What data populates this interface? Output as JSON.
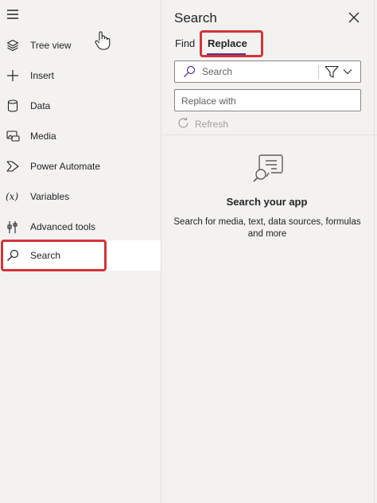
{
  "sidebar": {
    "items": [
      {
        "label": "Tree view",
        "icon": "layers-icon"
      },
      {
        "label": "Insert",
        "icon": "plus-icon"
      },
      {
        "label": "Data",
        "icon": "database-icon"
      },
      {
        "label": "Media",
        "icon": "media-icon"
      },
      {
        "label": "Power Automate",
        "icon": "power-automate-icon"
      },
      {
        "label": "Variables",
        "icon": "variables-icon"
      },
      {
        "label": "Advanced tools",
        "icon": "tools-icon"
      },
      {
        "label": "Search",
        "icon": "search-icon",
        "active": true
      }
    ]
  },
  "panel": {
    "title": "Search",
    "tabs": [
      {
        "label": "Find"
      },
      {
        "label": "Replace",
        "selected": true
      }
    ],
    "search_placeholder": "Search",
    "replace_placeholder": "Replace with",
    "refresh_label": "Refresh",
    "empty_title": "Search your app",
    "empty_description": "Search for media, text, data sources, formulas and more"
  },
  "colors": {
    "accent": "#5c2d91",
    "highlight": "#d13438",
    "background": "#f3f2f1"
  }
}
